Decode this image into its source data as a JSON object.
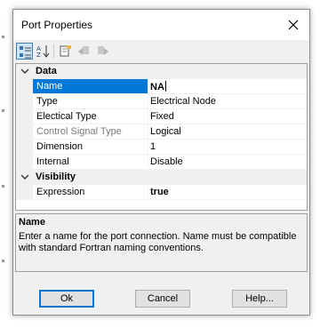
{
  "dialog": {
    "title": "Port Properties"
  },
  "toolbar": {
    "buttons": [
      {
        "name": "categorized-view",
        "icon": "categorized-icon",
        "active": true
      },
      {
        "name": "alphabetical-view",
        "icon": "sort-az-icon",
        "active": false
      },
      {
        "name": "property-pages",
        "icon": "property-pages-icon",
        "active": false
      },
      {
        "name": "back",
        "icon": "back-arrow-icon",
        "active": false
      },
      {
        "name": "forward",
        "icon": "forward-arrow-icon",
        "active": false
      }
    ]
  },
  "grid": {
    "categories": [
      {
        "label": "Data",
        "expanded": true,
        "rows": [
          {
            "name": "Name",
            "value": "NA",
            "selected": true,
            "editing": true
          },
          {
            "name": "Type",
            "value": "Electrical Node"
          },
          {
            "name": "Electical Type",
            "value": "Fixed"
          },
          {
            "name": "Control Signal Type",
            "value": "Logical",
            "disabled": true
          },
          {
            "name": "Dimension",
            "value": "1"
          },
          {
            "name": "Internal",
            "value": "Disable"
          }
        ]
      },
      {
        "label": "Visibility",
        "expanded": true,
        "rows": [
          {
            "name": "Expression",
            "value": "true",
            "bold": true
          }
        ]
      }
    ]
  },
  "help": {
    "title": "Name",
    "description": "Enter a name for the port connection. Name must be compatible with standard Fortran naming conventions."
  },
  "buttons": {
    "ok": "Ok",
    "cancel": "Cancel",
    "help": "Help..."
  },
  "colors": {
    "selection": "#0078d7",
    "panel": "#f0f0f0"
  }
}
